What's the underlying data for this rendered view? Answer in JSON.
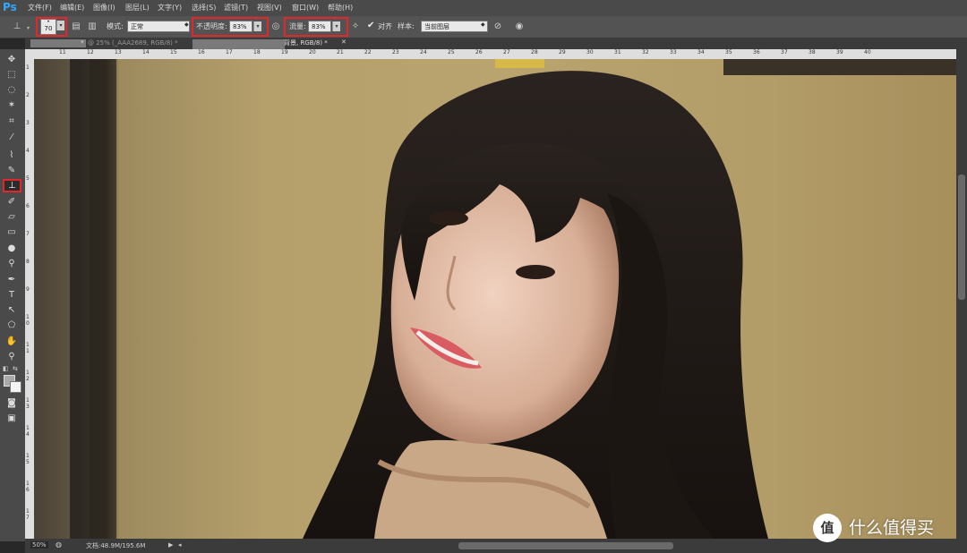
{
  "app": {
    "logo": "Ps"
  },
  "menu": [
    "文件(F)",
    "编辑(E)",
    "图像(I)",
    "图层(L)",
    "文字(Y)",
    "选择(S)",
    "滤镜(T)",
    "视图(V)",
    "窗口(W)",
    "帮助(H)"
  ],
  "options": {
    "brush_size": "70",
    "mode_label": "模式:",
    "mode_value": "正常",
    "opacity_label": "不透明度:",
    "opacity_value": "83%",
    "flow_label": "流量:",
    "flow_value": "83%",
    "align_label": "对齐",
    "align_checked": true,
    "sample_label": "样本:",
    "sample_value": "当前图层"
  },
  "tabs": [
    {
      "label": "@ 25% (_AAA2689, RGB/8) *"
    },
    {
      "label": "背景, RGB/8) *"
    }
  ],
  "ruler_top": [
    "11",
    "12",
    "13",
    "14",
    "15",
    "16",
    "17",
    "18",
    "19",
    "20",
    "21",
    "22",
    "23",
    "24",
    "25",
    "26",
    "27",
    "28",
    "29",
    "30",
    "31",
    "32",
    "33",
    "34",
    "35",
    "36",
    "37",
    "38",
    "39",
    "40"
  ],
  "ruler_left": [
    "1",
    "2",
    "3",
    "4",
    "5",
    "6",
    "7",
    "8",
    "9",
    "1 0",
    "1 1",
    "1 2",
    "1 3",
    "1 4",
    "1 5",
    "1 6",
    "1 7"
  ],
  "status": {
    "zoom": "50%",
    "doc": "文档:48.9M/195.6M"
  },
  "watermark": {
    "text": "什么值得买",
    "logo": "值"
  },
  "colors": {
    "highlight": "#e3262b",
    "ps_blue": "#31a8ff"
  },
  "tools": [
    "move-icon",
    "marquee-icon",
    "lasso-icon",
    "magic-wand-icon",
    "crop-icon",
    "eyedropper-icon",
    "healing-brush-icon",
    "brush-icon",
    "clone-stamp-icon",
    "history-brush-icon",
    "eraser-icon",
    "gradient-icon",
    "blur-icon",
    "dodge-icon",
    "pen-icon",
    "type-icon",
    "path-select-icon",
    "shape-icon",
    "hand-icon",
    "zoom-icon"
  ]
}
